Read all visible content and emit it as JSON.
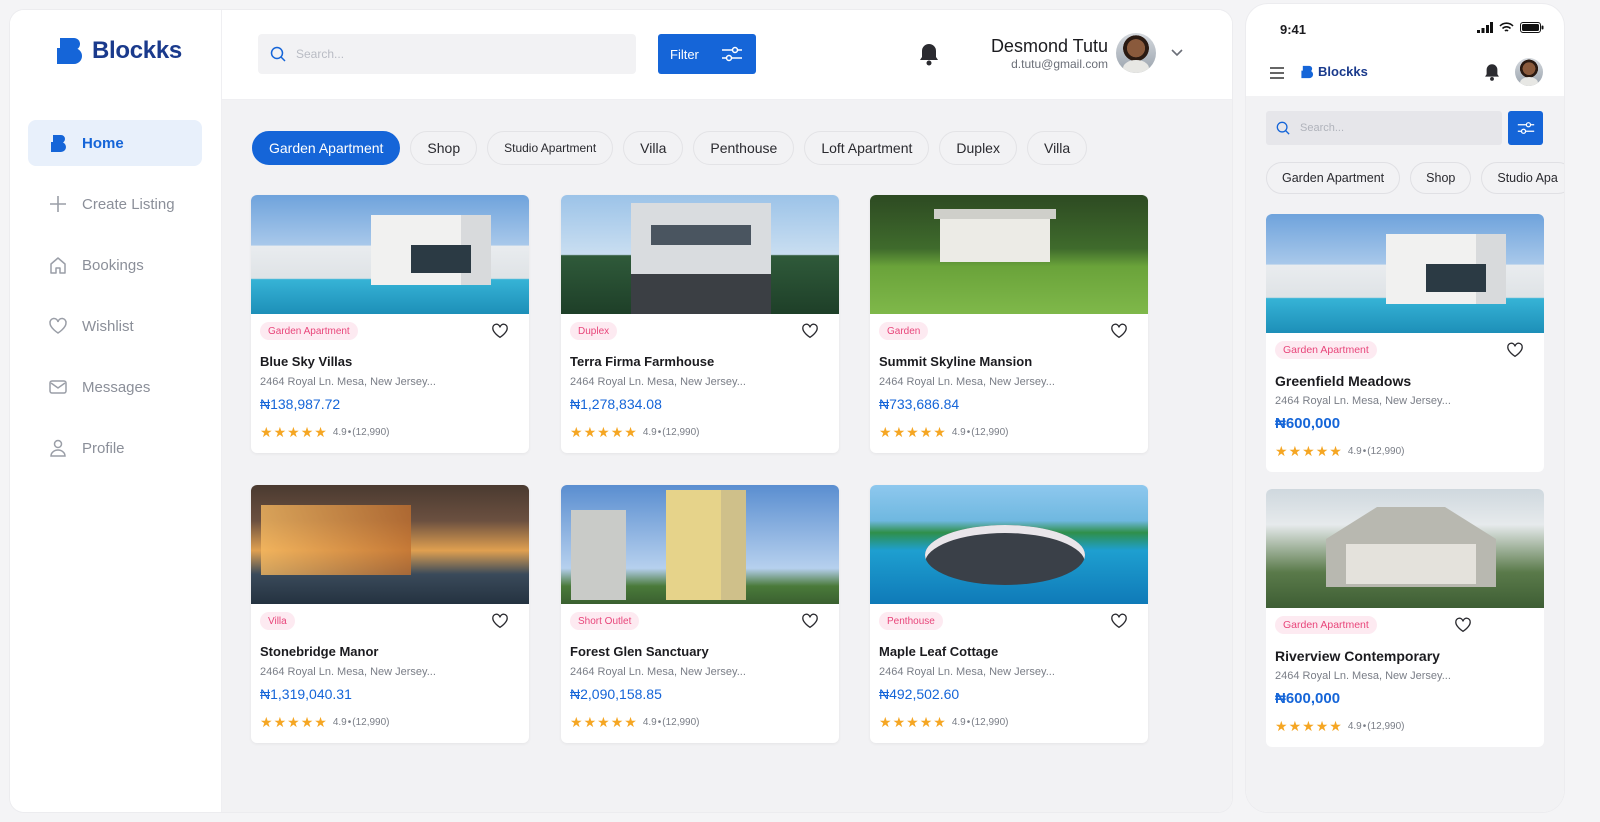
{
  "app": {
    "brand": "Blockks",
    "brand_color": "#1565d8"
  },
  "sidebar": {
    "items": [
      {
        "label": "Home",
        "icon": "home-icon"
      },
      {
        "label": "Create Listing",
        "icon": "plus-icon"
      },
      {
        "label": "Bookings",
        "icon": "house-icon"
      },
      {
        "label": "Wishlist",
        "icon": "heart-icon"
      },
      {
        "label": "Messages",
        "icon": "mail-icon"
      },
      {
        "label": "Profile",
        "icon": "user-icon"
      }
    ]
  },
  "header": {
    "search_placeholder": "Search...",
    "filter_label": "Filter",
    "user_name": "Desmond Tutu",
    "user_email": "d.tutu@gmail.com"
  },
  "categories": [
    "Garden Apartment",
    "Shop",
    "Studio Apartment",
    "Villa",
    "Penthouse",
    "Loft Apartment",
    "Duplex",
    "Villa"
  ],
  "listings": [
    {
      "tag": "Garden Apartment",
      "title": "Blue Sky Villas",
      "address": "2464 Royal Ln. Mesa, New Jersey...",
      "price": "₦138,987.72",
      "rating": "4.9",
      "reviews": "(12,990)",
      "stars": 5
    },
    {
      "tag": "Duplex",
      "title": "Terra Firma Farmhouse",
      "address": "2464 Royal Ln. Mesa, New Jersey...",
      "price": "₦1,278,834.08",
      "rating": "4.9",
      "reviews": "(12,990)",
      "stars": 5
    },
    {
      "tag": "Garden",
      "title": "Summit Skyline Mansion",
      "address": "2464 Royal Ln. Mesa, New Jersey...",
      "price": "₦733,686.84",
      "rating": "4.9",
      "reviews": "(12,990)",
      "stars": 5
    },
    {
      "tag": "Villa",
      "title": "Stonebridge Manor",
      "address": "2464 Royal Ln. Mesa, New Jersey...",
      "price": "₦1,319,040.31",
      "rating": "4.9",
      "reviews": "(12,990)",
      "stars": 5
    },
    {
      "tag": "Short Outlet",
      "title": "Forest Glen Sanctuary",
      "address": "2464 Royal Ln. Mesa, New Jersey...",
      "price": "₦2,090,158.85",
      "rating": "4.9",
      "reviews": "(12,990)",
      "stars": 5
    },
    {
      "tag": "Penthouse",
      "title": "Maple Leaf Cottage",
      "address": "2464 Royal Ln. Mesa, New Jersey...",
      "price": "₦492,502.60",
      "rating": "4.9",
      "reviews": "(12,990)",
      "stars": 5
    }
  ],
  "mobile": {
    "time": "9:41",
    "brand": "Blockks",
    "search_placeholder": "Search...",
    "categories": [
      "Garden Apartment",
      "Shop",
      "Studio Apa"
    ],
    "listings": [
      {
        "tag": "Garden Apartment",
        "title": "Greenfield Meadows",
        "address": "2464 Royal Ln. Mesa, New Jersey...",
        "price": "₦600,000",
        "rating": "4.9",
        "reviews": "(12,990)",
        "stars": 5
      },
      {
        "tag": "Garden Apartment",
        "title": "Riverview Contemporary",
        "address": "2464 Royal Ln. Mesa, New Jersey...",
        "price": "₦600,000",
        "rating": "4.9",
        "reviews": "(12,990)",
        "stars": 5
      }
    ]
  }
}
